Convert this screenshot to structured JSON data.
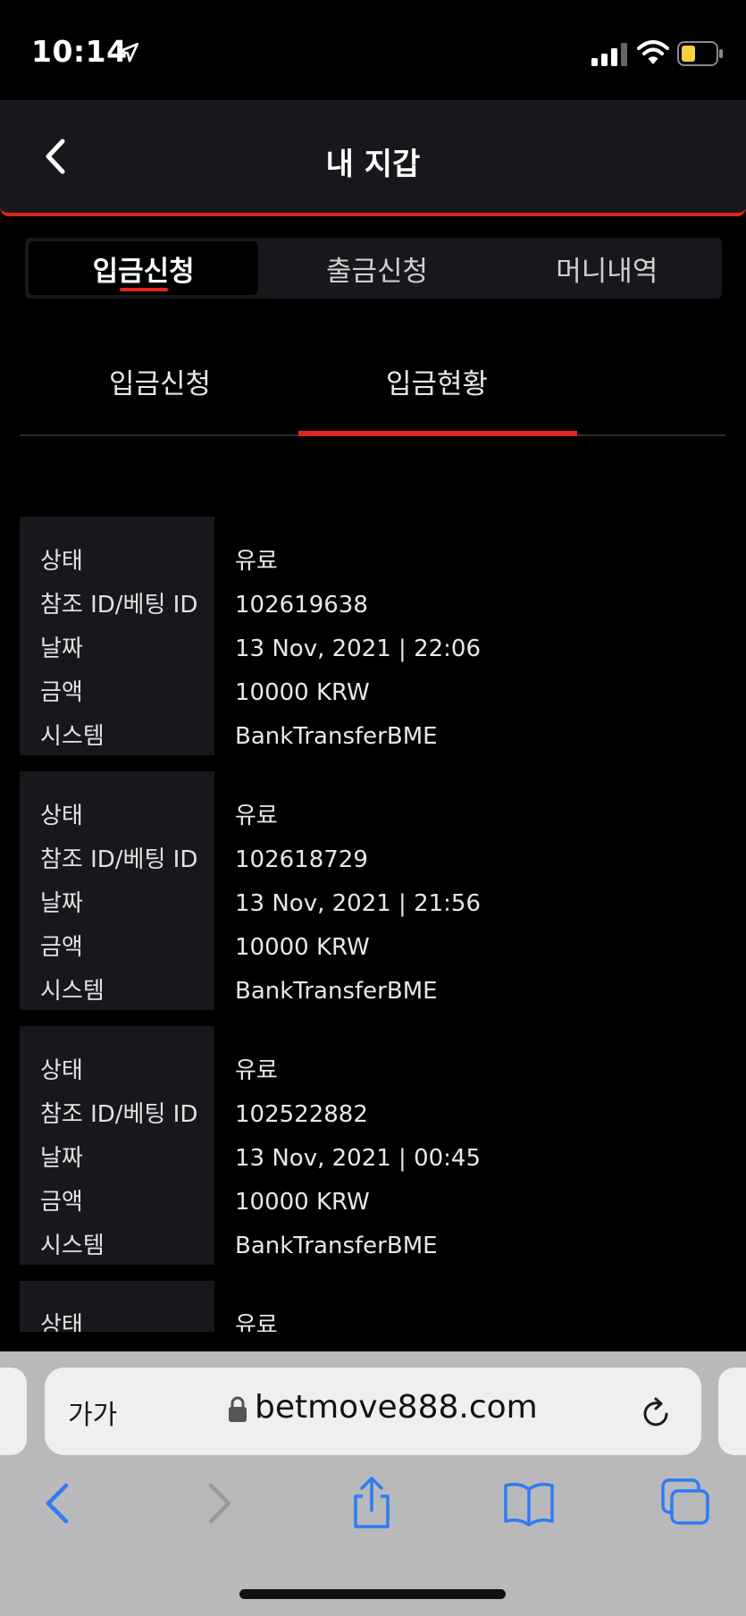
{
  "status_bar": {
    "time": "10:14"
  },
  "header": {
    "title": "내 지갑"
  },
  "main_tabs": [
    {
      "label": "입금신청"
    },
    {
      "label": "출금신청"
    },
    {
      "label": "머니내역"
    }
  ],
  "sub_tabs": [
    {
      "label": "입금신청"
    },
    {
      "label": "입금현황"
    }
  ],
  "labels": {
    "status": "상태",
    "ref_id": "참조 ID/베팅 ID",
    "date": "날짜",
    "amount": "금액",
    "system": "시스템"
  },
  "transactions": [
    {
      "status": "유료",
      "ref_id": "102619638",
      "date": "13 Nov, 2021 | 22:06",
      "amount": "10000 KRW",
      "system": "BankTransferBME"
    },
    {
      "status": "유료",
      "ref_id": "102618729",
      "date": "13 Nov, 2021 | 21:56",
      "amount": "10000 KRW",
      "system": "BankTransferBME"
    },
    {
      "status": "유료",
      "ref_id": "102522882",
      "date": "13 Nov, 2021 | 00:45",
      "amount": "10000 KRW",
      "system": "BankTransferBME"
    },
    {
      "status": "유료"
    }
  ],
  "browser": {
    "aa_label": "가가",
    "url": "betmove888.com"
  },
  "colors": {
    "accent": "#e0261d",
    "card_bg": "#17181c",
    "battery_fill": "#f5d142"
  }
}
